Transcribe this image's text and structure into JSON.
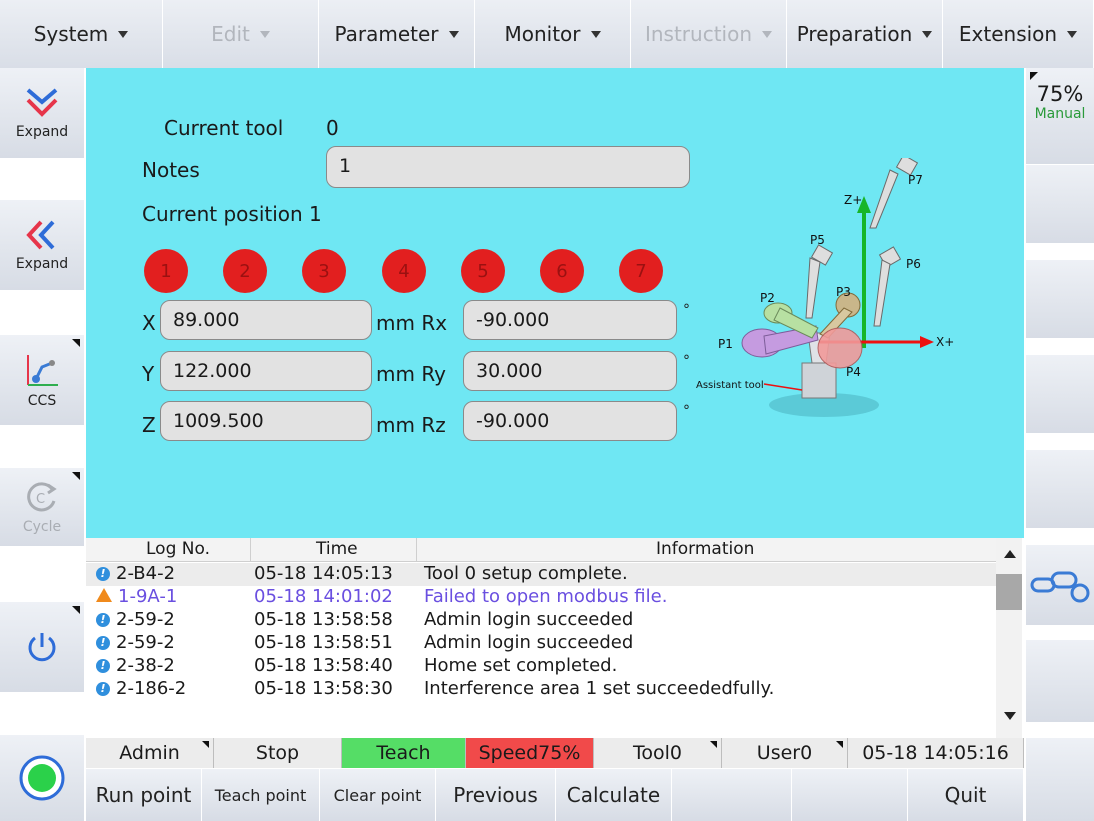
{
  "menu": {
    "system": "System",
    "edit": "Edit",
    "parameter": "Parameter",
    "monitor": "Monitor",
    "instruction": "Instruction",
    "preparation": "Preparation",
    "extension": "Extension"
  },
  "left": {
    "expand1": "Expand",
    "expand2": "Expand",
    "ccs": "CCS",
    "cycle": "Cycle"
  },
  "right": {
    "speed": "75%",
    "mode": "Manual"
  },
  "form": {
    "current_tool_label": "Current tool",
    "current_tool_value": "0",
    "notes_label": "Notes",
    "notes_value": "1",
    "current_position": "Current position 1",
    "points": [
      "1",
      "2",
      "3",
      "4",
      "5",
      "6",
      "7"
    ],
    "x_label": "X",
    "x_value": "89.000",
    "y_label": "Y",
    "y_value": "122.000",
    "z_label": "Z",
    "z_value": "1009.500",
    "rx_label": "mm Rx",
    "rx_value": "-90.000",
    "ry_label": "mm Ry",
    "ry_value": "30.000",
    "rz_label": "mm Rz",
    "rz_value": "-90.000",
    "deg": "°"
  },
  "diagram": {
    "p1": "P1",
    "p2": "P2",
    "p3": "P3",
    "p4": "P4",
    "p5": "P5",
    "p6": "P6",
    "p7": "P7",
    "zplus": "Z+",
    "xplus": "X+",
    "assistant": "Assistant tool"
  },
  "log": {
    "headers": {
      "no": "Log No.",
      "time": "Time",
      "info": "Information"
    },
    "rows": [
      {
        "no": "2-B4-2",
        "time": "05-18 14:05:13",
        "info": "Tool 0 setup complete."
      },
      {
        "no": "1-9A-1",
        "time": "05-18 14:01:02",
        "info": "Failed to open modbus file."
      },
      {
        "no": "2-59-2",
        "time": "05-18 13:58:58",
        "info": "Admin  login succeeded"
      },
      {
        "no": "2-59-2",
        "time": "05-18 13:58:51",
        "info": "Admin  login succeeded"
      },
      {
        "no": "2-38-2",
        "time": "05-18 13:58:40",
        "info": "Home set completed."
      },
      {
        "no": "2-186-2",
        "time": "05-18 13:58:30",
        "info": "Interference area 1 set succeededfully."
      }
    ]
  },
  "status": {
    "user": "Admin",
    "state": "Stop",
    "mode": "Teach",
    "speed": "Speed75%",
    "tool": "Tool0",
    "coord": "User0",
    "datetime": "05-18 14:05:16"
  },
  "bottom": {
    "run_point": "Run point",
    "teach_point": "Teach point",
    "clear_point": "Clear point",
    "previous": "Previous",
    "calculate": "Calculate",
    "quit": "Quit"
  },
  "colors": {
    "panel": "#6fe7f3",
    "point": "#e21f1f",
    "teach": "#55dd66",
    "speed": "#f14a4a",
    "warn_text": "#6a4fe0"
  }
}
